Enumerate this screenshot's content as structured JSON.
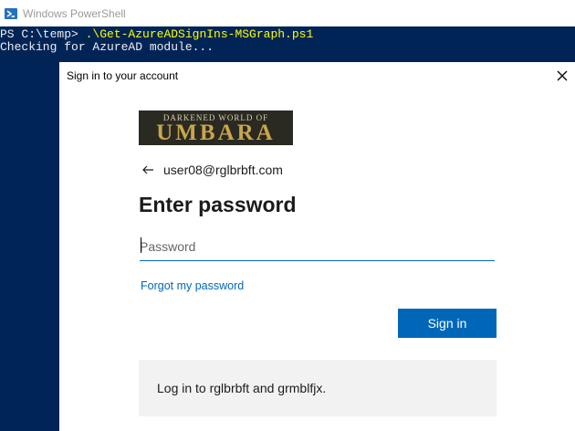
{
  "powershell": {
    "window_title": "Windows PowerShell",
    "prompt": "PS C:\\temp> ",
    "command": ".\\Get-AzureADSignIns-MSGraph.ps1",
    "output_line": "Checking for AzureAD module..."
  },
  "dialog": {
    "title": "Sign in to your account",
    "logo": {
      "line1": "DARKENED WORLD OF",
      "line2": "UMBARA"
    },
    "user_email": "user08@rglbrbft.com",
    "heading": "Enter password",
    "password_placeholder": "Password",
    "forgot_link": "Forgot my password",
    "signin_button": "Sign in",
    "info_text": "Log in to rglbrbft and grmblfjx."
  },
  "colors": {
    "console_background": "#012456",
    "command_text": "#ffff00",
    "accent": "#0067b8"
  }
}
